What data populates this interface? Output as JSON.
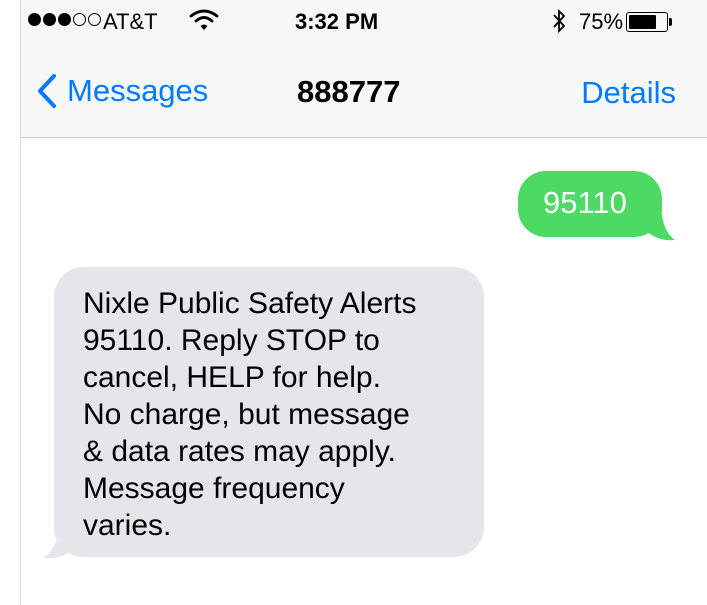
{
  "status_bar": {
    "signal_bars_filled": 3,
    "signal_bars_total": 5,
    "carrier": "AT&T",
    "wifi_icon": "wifi-icon",
    "time": "3:32 PM",
    "bluetooth_icon": "bluetooth-icon",
    "battery_percent": "75%",
    "battery_level": 0.75
  },
  "nav": {
    "back_label": "Messages",
    "title": "888777",
    "details_label": "Details"
  },
  "messages": [
    {
      "direction": "outgoing",
      "text": "95110"
    },
    {
      "direction": "incoming",
      "text": "Nixle Public Safety Alerts\n95110. Reply STOP to\ncancel, HELP for help.\nNo charge, but message\n& data rates may apply.\nMessage frequency\nvaries."
    }
  ],
  "colors": {
    "accent": "#007aff",
    "outgoing_bubble": "#4cd964",
    "incoming_bubble": "#e5e5ea",
    "bar_background": "#f7f7f7"
  }
}
